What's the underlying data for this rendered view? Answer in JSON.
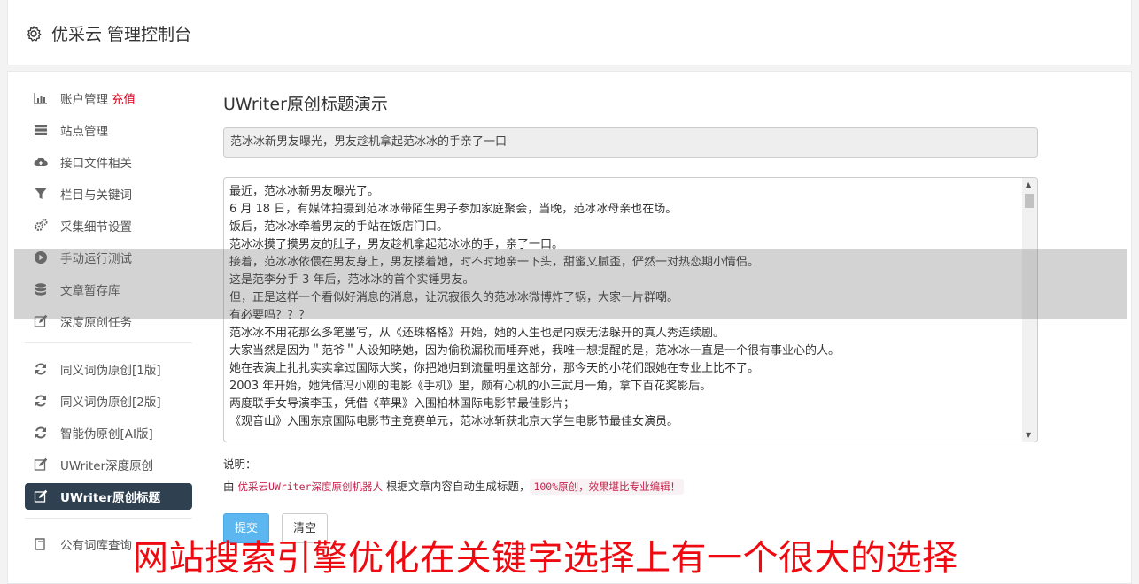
{
  "app": {
    "title": "优采云 管理控制台",
    "icon": "gear-icon"
  },
  "sidebar": {
    "group1": [
      {
        "label": "账户管理",
        "extra": "充值",
        "icon": "bar-chart-icon"
      },
      {
        "label": "站点管理",
        "icon": "server-icon"
      },
      {
        "label": "接口文件相关",
        "icon": "cloud-upload-icon"
      },
      {
        "label": "栏目与关键词",
        "icon": "filter-icon"
      },
      {
        "label": "采集细节设置",
        "icon": "gears-icon"
      },
      {
        "label": "手动运行测试",
        "icon": "play-circle-icon"
      },
      {
        "label": "文章暂存库",
        "icon": "database-icon"
      },
      {
        "label": "深度原创任务",
        "icon": "edit-icon"
      }
    ],
    "group2": [
      {
        "label": "同义词伪原创[1版]",
        "icon": "refresh-icon"
      },
      {
        "label": "同义词伪原创[2版]",
        "icon": "refresh-icon"
      },
      {
        "label": "智能伪原创[AI版]",
        "icon": "refresh-icon"
      },
      {
        "label": "UWriter深度原创",
        "icon": "edit-icon"
      },
      {
        "label": "UWriter原创标题",
        "icon": "edit-icon",
        "active": true
      }
    ],
    "group3": [
      {
        "label": "公有词库查询",
        "icon": "book-icon"
      }
    ]
  },
  "main": {
    "page_title": "UWriter原创标题演示",
    "title_value": "范冰冰新男友曝光，男友趁机拿起范冰冰的手亲了一口",
    "article_lines": [
      "最近，范冰冰新男友曝光了。",
      "6 月 18 日，有媒体拍摄到范冰冰带陌生男子参加家庭聚会，当晚，范冰冰母亲也在场。",
      "饭后，范冰冰牵着男友的手站在饭店门口。",
      "范冰冰摸了摸男友的肚子，男友趁机拿起范冰冰的手，亲了一口。",
      "接着，范冰冰依偎在男友身上，男友搂着她，时不时地亲一下头，甜蜜又腻歪，俨然一对热恋期小情侣。",
      "这是范李分手 3 年后，范冰冰的首个实锤男友。",
      "但，正是这样一个看似好消息的消息，让沉寂很久的范冰冰微博炸了锅，大家一片群嘲。",
      "有必要吗？？？",
      "范冰冰不用花那么多笔墨写，从《还珠格格》开始，她的人生也是内娱无法躲开的真人秀连续剧。",
      "大家当然是因为＂范爷＂人设知晓她，因为偷税漏税而唾弃她，我唯一想提醒的是，范冰冰一直是一个很有事业心的人。",
      "她在表演上扎扎实实拿过国际大奖，你把她归到流量明星这部分，那今天的小花们跟她在专业上比不了。",
      "2003 年开始，她凭借冯小刚的电影《手机》里，颇有心机的小三武月一角，拿下百花奖影后。",
      "两度联手女导演李玉，凭借《苹果》入围柏林国际电影节最佳影片；",
      "《观音山》入围东京国际电影节主竞赛单元，范冰冰斩获北京大学生电影节最佳女演员。"
    ],
    "note_label": "说明：",
    "note_prefix": "由 ",
    "note_link": "优采云UWriter深度原创机器人",
    "note_middle": " 根据文章内容自动生成标题，",
    "note_badge": "100%原创，效果堪比专业编辑！",
    "submit_label": "提交",
    "clear_label": "清空"
  },
  "watermark": "网站搜索引擎优化在关键字选择上有一个很大的选择",
  "colors": {
    "active_bg": "#2f4050",
    "primary": "#5cb6f0",
    "accent_red": "#d9001b",
    "watermark_red": "#ee0a10"
  }
}
